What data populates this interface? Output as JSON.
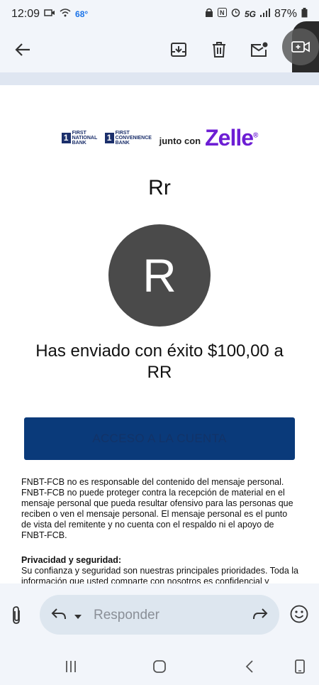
{
  "status": {
    "time": "12:09",
    "temp": "68°",
    "network": "5G",
    "battery": "87%"
  },
  "email": {
    "bank_name_1": "FIRST NATIONAL BANK",
    "bank_name_2": "FIRST CONVENIENCE BANK",
    "junto": "junto con",
    "zelle": "Zelle",
    "recipient_name": "Rr",
    "avatar_letter": "R",
    "success_message": "Has enviado con éxito $100,00 a RR",
    "access_button": "ACCESO A LA CUENTA",
    "disclaimer": "FNBT-FCB no es responsable del contenido del mensaje personal. FNBT-FCB no puede proteger contra la recepción de material en el mensaje personal que pueda resultar ofensivo para las personas que reciben o ven el mensaje personal. El mensaje personal es el punto de vista del remitente y no cuenta con el respaldo ni el apoyo de FNBT-FCB.",
    "privacy_heading": "Privacidad y seguridad:",
    "privacy_text": "Su confianza y seguridad son nuestras principales prioridades. Toda la información que usted comparte con nosotros es confidencial y"
  },
  "reply": {
    "placeholder": "Responder"
  }
}
